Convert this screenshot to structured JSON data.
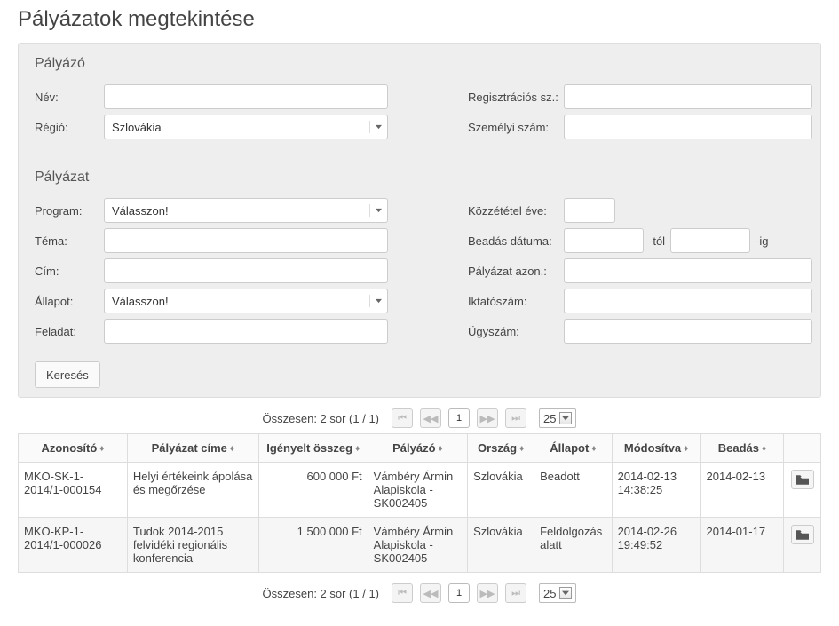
{
  "page_title": "Pályázatok megtekintése",
  "applicant": {
    "section": "Pályázó",
    "name_label": "Név:",
    "region_label": "Régió:",
    "region_value": "Szlovákia",
    "reg_label": "Regisztrációs sz.:",
    "personal_label": "Személyi szám:"
  },
  "application": {
    "section": "Pályázat",
    "program_label": "Program:",
    "program_value": "Válasszon!",
    "topic_label": "Téma:",
    "title_label": "Cím:",
    "state_label": "Állapot:",
    "state_value": "Válasszon!",
    "task_label": "Feladat:",
    "pubyear_label": "Közzététel éve:",
    "subdate_label": "Beadás dátuma:",
    "from_suffix": "-tól",
    "to_suffix": "-ig",
    "appid_label": "Pályázat azon.:",
    "fileno_label": "Iktatószám:",
    "caseno_label": "Ügyszám:"
  },
  "search_label": "Keresés",
  "pager": {
    "summary": "Összesen: 2 sor (1 / 1)",
    "current_page": "1",
    "page_size": "25"
  },
  "columns": {
    "id": "Azonosító",
    "title": "Pályázat címe",
    "amount": "Igényelt összeg",
    "applicant": "Pályázó",
    "country": "Ország",
    "state": "Állapot",
    "modified": "Módosítva",
    "submitted": "Beadás"
  },
  "rows": [
    {
      "id": "MKO-SK-1-2014/1-000154",
      "title": "Helyi értékeink ápolása és megőrzése",
      "amount": "600 000 Ft",
      "applicant": "Vámbéry Ármin Alapiskola - SK002405",
      "country": "Szlovákia",
      "state": "Beadott",
      "modified": "2014-02-13 14:38:25",
      "submitted": "2014-02-13"
    },
    {
      "id": "MKO-KP-1-2014/1-000026",
      "title": "Tudok 2014-2015 felvidéki regionális konferencia",
      "amount": "1 500 000 Ft",
      "applicant": "Vámbéry Ármin Alapiskola - SK002405",
      "country": "Szlovákia",
      "state": "Feldolgozás alatt",
      "modified": "2014-02-26 19:49:52",
      "submitted": "2014-01-17"
    }
  ]
}
